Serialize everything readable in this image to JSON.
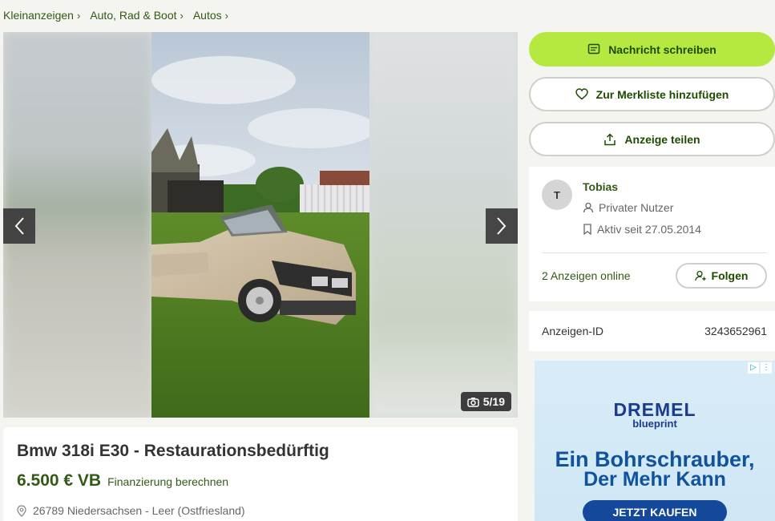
{
  "breadcrumb": [
    {
      "label": "Kleinanzeigen"
    },
    {
      "label": "Auto, Rad & Boot"
    },
    {
      "label": "Autos"
    }
  ],
  "gallery": {
    "counter": "5/19",
    "prev_icon": "chevron-left-icon",
    "next_icon": "chevron-right-icon",
    "counter_icon": "camera-icon"
  },
  "listing": {
    "title": "Bmw 318i E30 - Restaurationsbedürftig",
    "price": "6.500 € VB",
    "financing_link": "Finanzierung berechnen",
    "location": "26789 Niedersachsen - Leer (Ostfriesland)"
  },
  "actions": {
    "message": "Nachricht schreiben",
    "watchlist": "Zur Merkliste hinzufügen",
    "share": "Anzeige teilen"
  },
  "seller": {
    "initial": "T",
    "name": "Tobias",
    "type": "Privater Nutzer",
    "active_since": "Aktiv seit 27.05.2014",
    "ads_online": "2 Anzeigen online",
    "follow": "Folgen"
  },
  "listing_id": {
    "label": "Anzeigen-ID",
    "value": "3243652961"
  },
  "ad": {
    "brand": "DREMEL",
    "brand_sub": "blueprint",
    "headline_1": "Ein Bohrschrauber,",
    "headline_2": "Der Mehr Kann",
    "cta": "JETZT KAUFEN"
  },
  "colors": {
    "accent_green": "#b5e941",
    "text_green": "#325a16",
    "page_bg": "#f4f4f0"
  }
}
